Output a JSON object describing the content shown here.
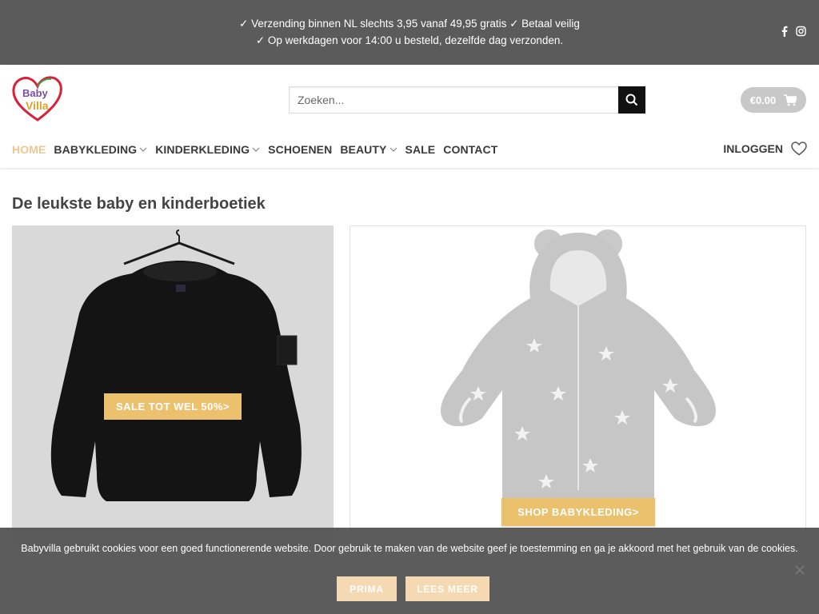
{
  "topbar": {
    "line1": "✓ Verzending binnen NL slechts 3,95 vanaf 49,95 gratis ✓ Betaal veilig",
    "line2": "✓ Op werkdagen voor 14:00 u besteld, dezelfde dag verzonden.",
    "icons": [
      "facebook-icon",
      "instagram-icon"
    ]
  },
  "logo": {
    "line1": "Baby",
    "line2": "Villa"
  },
  "search": {
    "placeholder": "Zoeken..."
  },
  "cart": {
    "amount": "€0.00"
  },
  "nav": {
    "items": [
      {
        "label": "HOME",
        "active": true,
        "dropdown": false
      },
      {
        "label": "BABYKLEDING",
        "active": false,
        "dropdown": true
      },
      {
        "label": "KINDERKLEDING",
        "active": false,
        "dropdown": true
      },
      {
        "label": "SCHOENEN",
        "active": false,
        "dropdown": false
      },
      {
        "label": "BEAUTY",
        "active": false,
        "dropdown": true
      },
      {
        "label": "SALE",
        "active": false,
        "dropdown": false
      },
      {
        "label": "CONTACT",
        "active": false,
        "dropdown": false
      }
    ],
    "login": "INLOGGEN"
  },
  "main": {
    "title": "De leukste baby en kinderboetiek",
    "banners": [
      {
        "cta": "SALE TOT WEL 50%>"
      },
      {
        "cta": "SHOP BABYKLEDING>"
      }
    ]
  },
  "cookie": {
    "text": "Babyvilla gebruikt cookies voor een goed functionerende website. Door gebruik te maken van de website geef je toestemming en ga je akkoord met het gebruik van de cookies.",
    "accept": "PRIMA",
    "more": "LEES MEER"
  },
  "colors": {
    "topbar": "#5b5b5b",
    "accent": "#ecc16d",
    "active_nav": "#ecc894",
    "cookie_button": "#f5d9b2"
  }
}
